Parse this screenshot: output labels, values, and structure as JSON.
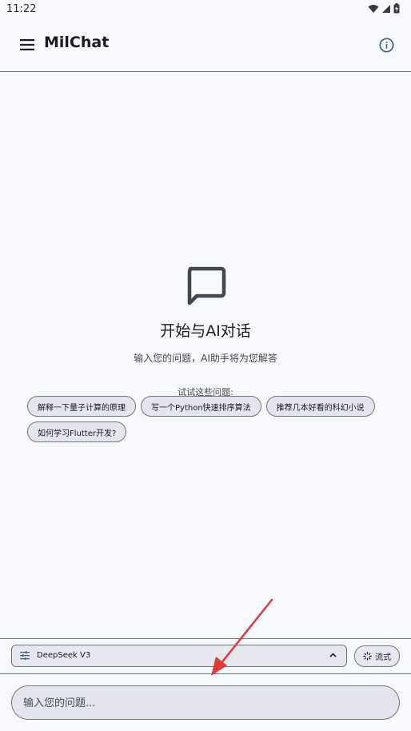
{
  "status_bar": {
    "time": "11:22"
  },
  "app_bar": {
    "title": "MilChat",
    "menu_icon": "menu-icon",
    "info_icon": "info-icon"
  },
  "empty_state": {
    "icon": "chat-bubble-icon",
    "title": "开始与AI对话",
    "subtitle": "输入您的问题，AI助手将为您解答",
    "try_label": "试试这些问题:"
  },
  "suggestions": [
    "解释一下量子计算的原理",
    "写一个Python快速排序算法",
    "推荐几本好看的科幻小说",
    "如何学习Flutter开发?"
  ],
  "model_selector": {
    "label": "DeepSeek V3"
  },
  "stream_toggle": {
    "label": "流式"
  },
  "message_input": {
    "placeholder": "输入您的问题..."
  },
  "colors": {
    "background": "#f8f9fe",
    "surface": "#e3e4ec",
    "outline": "#74767d",
    "accent": "#3f5f90",
    "annotation_arrow": "#e53935"
  }
}
